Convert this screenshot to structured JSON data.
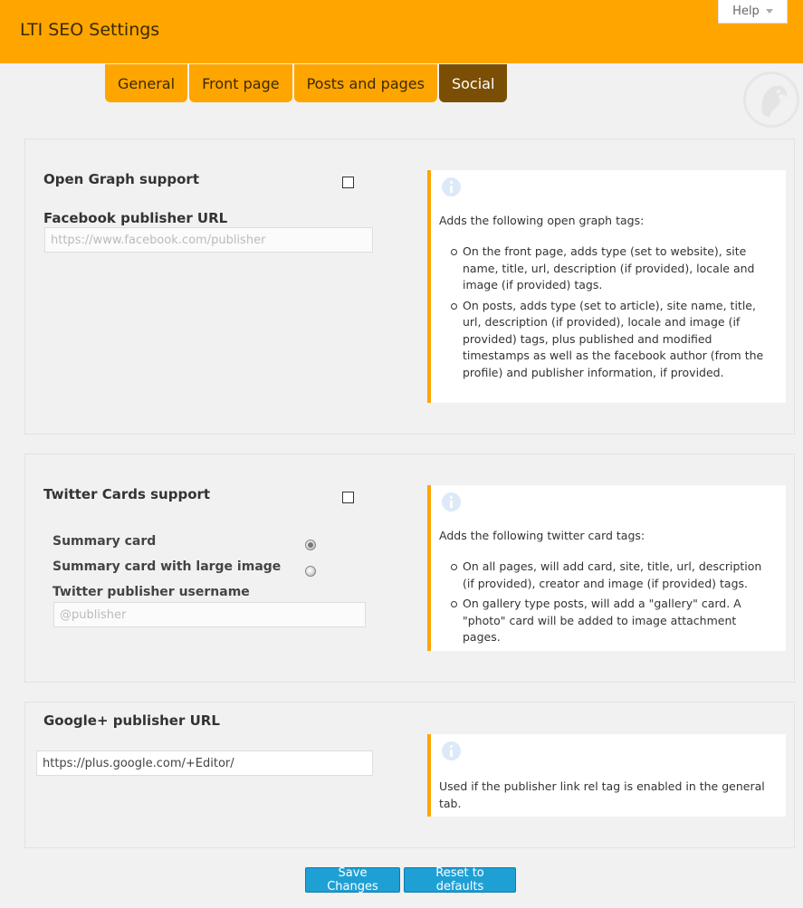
{
  "header": {
    "title": "LTI SEO Settings",
    "help_label": "Help"
  },
  "tabs": [
    {
      "label": "General",
      "active": false
    },
    {
      "label": "Front page",
      "active": false
    },
    {
      "label": "Posts and pages",
      "active": false
    },
    {
      "label": "Social",
      "active": true
    }
  ],
  "open_graph": {
    "label": "Open Graph support",
    "checked": false,
    "facebook_label": "Facebook publisher URL",
    "facebook_placeholder": "https://www.facebook.com/publisher",
    "facebook_value": "",
    "info": {
      "intro": "Adds the following open graph tags:",
      "items": [
        "On the front page, adds type (set to website), site name, title, url, description (if provided), locale and image (if provided) tags.",
        "On posts, adds type (set to article), site name, title, url, description (if provided), locale and image (if provided) tags, plus published and modified timestamps as well as the facebook author (from the profile) and publisher information, if provided."
      ]
    }
  },
  "twitter": {
    "label": "Twitter Cards support",
    "checked": false,
    "summary_label": "Summary card",
    "summary_selected": true,
    "large_image_label": "Summary card with large image",
    "large_image_selected": false,
    "username_label": "Twitter publisher username",
    "username_placeholder": "@publisher",
    "username_value": "",
    "info": {
      "intro": "Adds the following twitter card tags:",
      "items": [
        "On all pages, will add card, site, title, url, description (if provided), creator and image (if provided) tags.",
        "On gallery type posts, will add a \"gallery\" card. A \"photo\" card will be added to image attachment pages."
      ]
    }
  },
  "google": {
    "label": "Google+ publisher URL",
    "value": "https://plus.google.com/+Editor/",
    "info": {
      "intro": "Used if the publisher link rel tag is enabled in the general tab."
    }
  },
  "buttons": {
    "save": "Save Changes",
    "reset": "Reset to defaults"
  },
  "colors": {
    "accent": "#ffa500",
    "active_tab": "#7a4f05",
    "button": "#1ea0d5",
    "info_icon": "#dce9f8"
  }
}
